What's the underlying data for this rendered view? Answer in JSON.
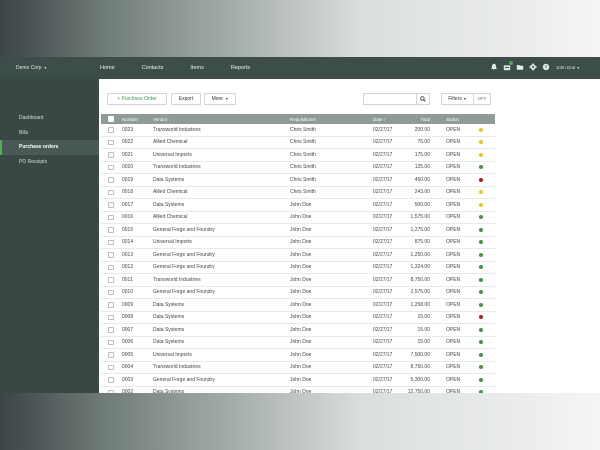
{
  "header": {
    "company": "Demo Corp",
    "nav": [
      "Home",
      "Contacts",
      "Items",
      "Reports"
    ],
    "user": "John Doe"
  },
  "sidebar": {
    "items": [
      {
        "label": "Dashboard",
        "active": false
      },
      {
        "label": "Bills",
        "active": false
      },
      {
        "label": "Purchase orders",
        "active": true
      },
      {
        "label": "PO Receipts",
        "active": false
      }
    ]
  },
  "toolbar": {
    "purchase_order_label": "+ Purchase Order",
    "export_label": "Export",
    "more_label": "More",
    "search_value": "",
    "filters_label": "Filters",
    "filters_toggle": "OFF"
  },
  "table": {
    "headers": {
      "number": "Number",
      "vendor": "Vendor",
      "requisitioner": "Requisitioner",
      "date": "Date ↑",
      "total": "Total",
      "status": "Status"
    },
    "rows": [
      {
        "number": "0023",
        "vendor": "Transworld Industries",
        "requisitioner": "Chris Smith",
        "date": "02/27/17",
        "total": "200.00",
        "status": "OPEN",
        "indicator": "yellow"
      },
      {
        "number": "0022",
        "vendor": "Allied Chemical",
        "requisitioner": "Chris Smith",
        "date": "02/27/17",
        "total": "75.00",
        "status": "OPEN",
        "indicator": "yellow"
      },
      {
        "number": "0021",
        "vendor": "Universal Imports",
        "requisitioner": "Chris Smith",
        "date": "02/27/17",
        "total": "175.00",
        "status": "OPEN",
        "indicator": "yellow"
      },
      {
        "number": "0020",
        "vendor": "Transworld Industries",
        "requisitioner": "Chris Smith",
        "date": "02/27/17",
        "total": "125.00",
        "status": "OPEN",
        "indicator": "green"
      },
      {
        "number": "0019",
        "vendor": "Data Systems",
        "requisitioner": "Chris Smith",
        "date": "02/27/17",
        "total": "450.00",
        "status": "OPEN",
        "indicator": "red"
      },
      {
        "number": "0018",
        "vendor": "Allied Chemical",
        "requisitioner": "Chris Smith",
        "date": "02/27/17",
        "total": "243.00",
        "status": "OPEN",
        "indicator": "yellow"
      },
      {
        "number": "0017",
        "vendor": "Data Systems",
        "requisitioner": "John Doe",
        "date": "02/27/17",
        "total": "500.00",
        "status": "OPEN",
        "indicator": "yellow"
      },
      {
        "number": "0016",
        "vendor": "Allied Chemical",
        "requisitioner": "John Doe",
        "date": "02/27/17",
        "total": "1,575.00",
        "status": "OPEN",
        "indicator": "green"
      },
      {
        "number": "0015",
        "vendor": "General Forge and Foundry",
        "requisitioner": "John Doe",
        "date": "02/27/17",
        "total": "1,275.00",
        "status": "OPEN",
        "indicator": "green"
      },
      {
        "number": "0014",
        "vendor": "Universal Imports",
        "requisitioner": "John Doe",
        "date": "02/27/17",
        "total": "875.00",
        "status": "OPEN",
        "indicator": "green"
      },
      {
        "number": "0013",
        "vendor": "General Forge and Foundry",
        "requisitioner": "John Doe",
        "date": "02/27/17",
        "total": "1,250.00",
        "status": "OPEN",
        "indicator": "green"
      },
      {
        "number": "0012",
        "vendor": "General Forge and Foundry",
        "requisitioner": "John Doe",
        "date": "02/27/17",
        "total": "1,324.00",
        "status": "OPEN",
        "indicator": "green"
      },
      {
        "number": "0011",
        "vendor": "Transworld Industries",
        "requisitioner": "John Doe",
        "date": "02/27/17",
        "total": "8,750.00",
        "status": "OPEN",
        "indicator": "green"
      },
      {
        "number": "0010",
        "vendor": "General Forge and Foundry",
        "requisitioner": "John Doe",
        "date": "02/27/17",
        "total": "2,575.00",
        "status": "OPEN",
        "indicator": "green"
      },
      {
        "number": "0009",
        "vendor": "Data Systems",
        "requisitioner": "John Doe",
        "date": "02/27/17",
        "total": "1,258.00",
        "status": "OPEN",
        "indicator": "green"
      },
      {
        "number": "0008",
        "vendor": "Data Systems",
        "requisitioner": "John Doe",
        "date": "02/27/17",
        "total": "15.00",
        "status": "OPEN",
        "indicator": "red"
      },
      {
        "number": "0007",
        "vendor": "Data Systems",
        "requisitioner": "John Doe",
        "date": "02/27/17",
        "total": "15.00",
        "status": "OPEN",
        "indicator": "green"
      },
      {
        "number": "0006",
        "vendor": "Data Systems",
        "requisitioner": "John Doe",
        "date": "02/27/17",
        "total": "15.00",
        "status": "OPEN",
        "indicator": "green"
      },
      {
        "number": "0005",
        "vendor": "Universal Imports",
        "requisitioner": "John Doe",
        "date": "02/27/17",
        "total": "7,500.00",
        "status": "OPEN",
        "indicator": "green"
      },
      {
        "number": "0004",
        "vendor": "Transworld Industries",
        "requisitioner": "John Doe",
        "date": "02/27/17",
        "total": "8,750.00",
        "status": "OPEN",
        "indicator": "green"
      },
      {
        "number": "0003",
        "vendor": "General Forge and Foundry",
        "requisitioner": "John Doe",
        "date": "02/27/17",
        "total": "5,300.00",
        "status": "OPEN",
        "indicator": "green"
      },
      {
        "number": "0002",
        "vendor": "Data Systems",
        "requisitioner": "John Doe",
        "date": "02/27/17",
        "total": "12,750.00",
        "status": "OPEN",
        "indicator": "green"
      }
    ]
  },
  "colors": {
    "topbar": "#3d4d49",
    "sidebar": "#3a4845",
    "accent": "#4caf50",
    "table_header": "#8e9b97",
    "status_yellow": "#f2c517",
    "status_green": "#3a9b43",
    "status_red": "#b71c1c"
  }
}
